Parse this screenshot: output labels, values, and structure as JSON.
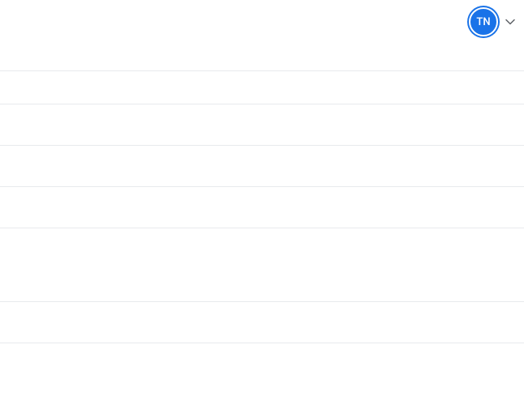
{
  "header": {
    "avatar_initials": "TN",
    "avatar_bg": "#1a73e8"
  },
  "rows": [
    {},
    {},
    {},
    {},
    {},
    {}
  ]
}
